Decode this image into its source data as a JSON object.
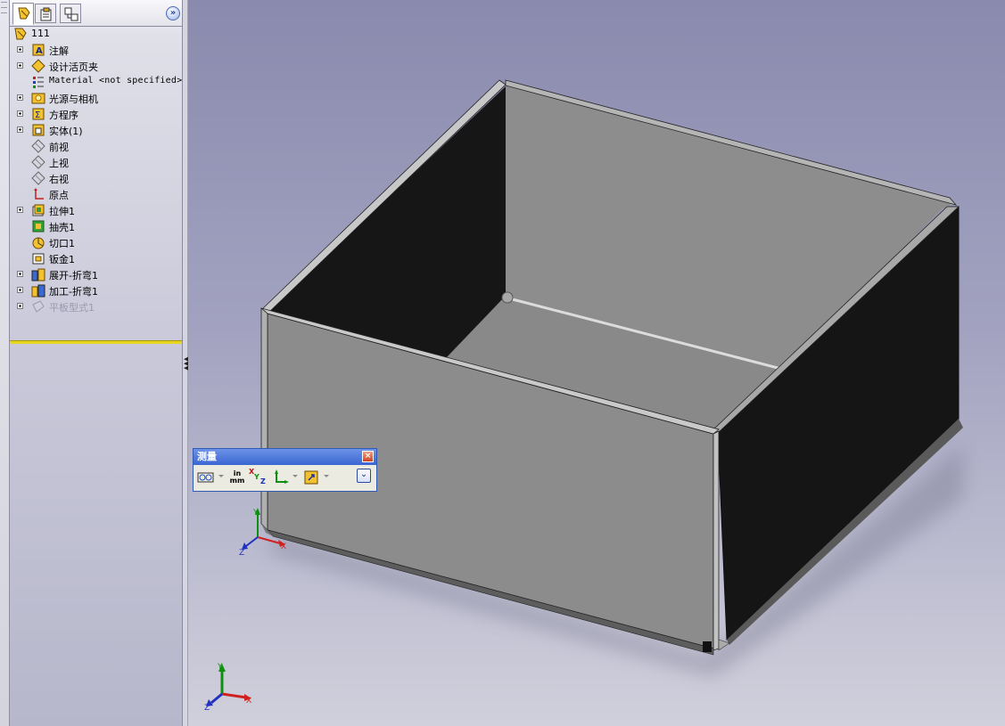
{
  "panel": {
    "tabs": [
      "feature-manager-tab",
      "property-manager-tab",
      "configuration-manager-tab"
    ],
    "root_label": "111",
    "tree": [
      {
        "label": "注解",
        "expand": true,
        "icon": "annotations-icon"
      },
      {
        "label": "设计活页夹",
        "expand": true,
        "icon": "design-binder-icon"
      },
      {
        "label": "Material <not specified>",
        "expand": false,
        "icon": "material-icon",
        "mono": true
      },
      {
        "label": "光源与相机",
        "expand": true,
        "icon": "lights-cameras-icon"
      },
      {
        "label": "方程序",
        "expand": true,
        "icon": "equations-icon"
      },
      {
        "label": "实体(1)",
        "expand": true,
        "icon": "solid-bodies-icon"
      },
      {
        "label": "前视",
        "expand": false,
        "icon": "plane-icon"
      },
      {
        "label": "上视",
        "expand": false,
        "icon": "plane-icon"
      },
      {
        "label": "右视",
        "expand": false,
        "icon": "plane-icon"
      },
      {
        "label": "原点",
        "expand": false,
        "icon": "origin-icon"
      },
      {
        "label": "拉伸1",
        "expand": true,
        "icon": "extrude-icon"
      },
      {
        "label": "抽壳1",
        "expand": false,
        "icon": "shell-icon"
      },
      {
        "label": "切口1",
        "expand": false,
        "icon": "rip-icon"
      },
      {
        "label": "钣金1",
        "expand": false,
        "icon": "sheet-metal-icon"
      },
      {
        "label": "展开-折弯1",
        "expand": true,
        "icon": "flatten-bends-icon"
      },
      {
        "label": "加工-折弯1",
        "expand": true,
        "icon": "process-bends-icon"
      },
      {
        "label": "平板型式1",
        "expand": true,
        "icon": "flat-pattern-icon",
        "dim": true
      }
    ]
  },
  "measure": {
    "title": "测量",
    "close": "×",
    "units_top": "in",
    "units_bottom": "mm",
    "xyz_x": "X",
    "xyz_y": "Y",
    "xyz_z": "Z"
  },
  "triad_labels": {
    "x": "X",
    "y": "Y",
    "z": "Z"
  },
  "colors": {
    "selection_blue": "#315ab5",
    "rollback_bar": "#e7d51f",
    "axis_x": "#d02020",
    "axis_y": "#109010",
    "axis_z": "#2030c0"
  }
}
